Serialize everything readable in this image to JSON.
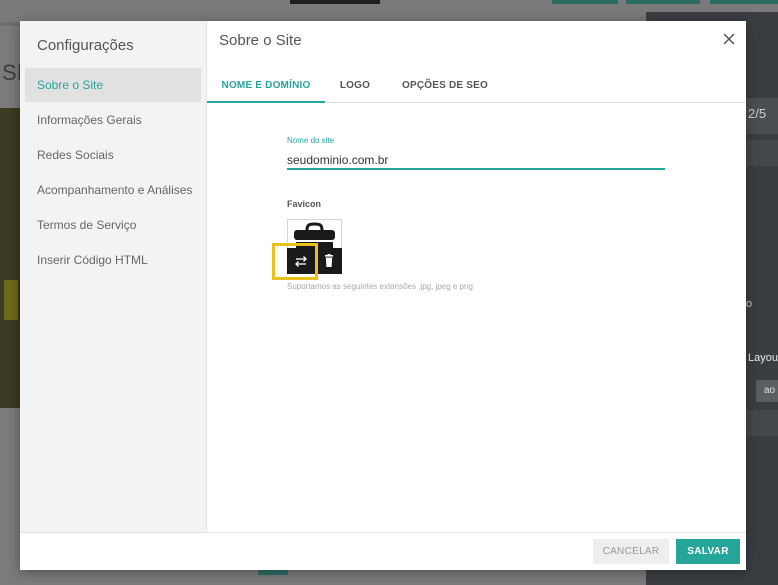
{
  "background": {
    "partial_heading": "SI",
    "pager": "2/5",
    "partial_text_o": "o",
    "partial_layout": "Layou",
    "partial_ao": "ao"
  },
  "sidebar": {
    "title": "Configurações",
    "items": [
      {
        "label": "Sobre o Site",
        "active": true
      },
      {
        "label": "Informações Gerais"
      },
      {
        "label": "Redes Sociais"
      },
      {
        "label": "Acompanhamento e Análises"
      },
      {
        "label": "Termos de Serviço"
      },
      {
        "label": "Inserir Código HTML"
      }
    ]
  },
  "main": {
    "title": "Sobre o Site",
    "tabs": [
      {
        "label": "NOME E DOMÍNIO",
        "active": true
      },
      {
        "label": "LOGO"
      },
      {
        "label": "OPÇÕES DE SEO"
      }
    ],
    "site_name": {
      "label": "Nome do site",
      "value": "seudominio.com.br"
    },
    "favicon": {
      "label": "Favicon",
      "hint": "Suportamos as seguintes extensões .jpg, jpeg e png"
    }
  },
  "footer": {
    "cancel_label": "CANCELAR",
    "save_label": "SALVAR"
  },
  "colors": {
    "accent": "#26a69a",
    "highlight": "#e8c21a"
  },
  "icons": {
    "close": "close-icon",
    "favicon_image": "briefcase-icon",
    "swap": "swap-icon",
    "delete": "trash-icon"
  }
}
